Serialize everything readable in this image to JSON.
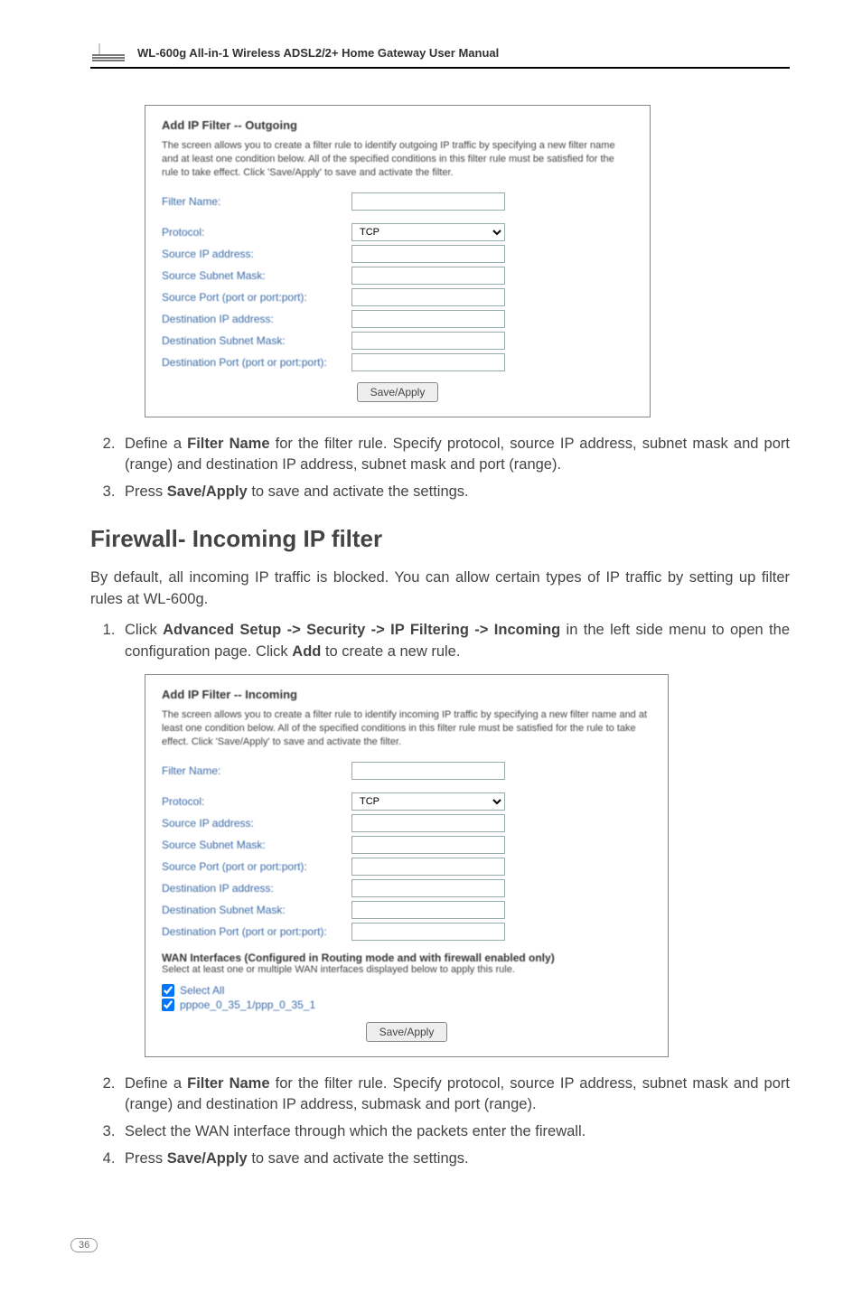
{
  "header": {
    "manual_title": "WL-600g All-in-1 Wireless ADSL2/2+ Home Gateway User Manual"
  },
  "dialog_out": {
    "title": "Add IP Filter -- Outgoing",
    "desc": "The screen allows you to create a filter rule to identify outgoing IP traffic by specifying a new filter name and at least one condition below. All of the specified conditions in this filter rule must be satisfied for the rule to take effect. Click 'Save/Apply' to save and activate the filter.",
    "labels": {
      "filter_name": "Filter Name:",
      "protocol": "Protocol:",
      "src_ip": "Source IP address:",
      "src_mask": "Source Subnet Mask:",
      "src_port": "Source Port (port or port:port):",
      "dst_ip": "Destination IP address:",
      "dst_mask": "Destination Subnet Mask:",
      "dst_port": "Destination Port (port or port:port):"
    },
    "protocol_value": "TCP",
    "button": "Save/Apply"
  },
  "steps_out": {
    "s2": "Define a <b>Filter Name</b> for the filter rule. Specify protocol, source IP address, subnet mask and port (range) and destination IP address, subnet mask and port (range).",
    "s3_pre": "Press ",
    "s3_bold": "Save/Apply",
    "s3_post": " to save and activate the settings."
  },
  "section_title": "Firewall- Incoming IP filter",
  "section_intro": "By default, all incoming IP traffic is blocked. You can allow certain types of IP traffic by setting up filter rules at WL-600g.",
  "steps_in_top": {
    "s1_pre": "Click ",
    "s1_bold": "Advanced Setup -> Security -> IP Filtering -> Incoming",
    "s1_mid": " in the left side menu to open the configuration page. Click ",
    "s1_bold2": "Add",
    "s1_post": " to create a new rule."
  },
  "dialog_in": {
    "title": "Add IP Filter -- Incoming",
    "desc": "The screen allows you to create a filter rule to identify incoming IP traffic by specifying a new filter name and at least one condition below. All of the specified conditions in this filter rule must be satisfied for the rule to take effect. Click 'Save/Apply' to save and activate the filter.",
    "labels": {
      "filter_name": "Filter Name:",
      "protocol": "Protocol:",
      "src_ip": "Source IP address:",
      "src_mask": "Source Subnet Mask:",
      "src_port": "Source Port (port or port:port):",
      "dst_ip": "Destination IP address:",
      "dst_mask": "Destination Subnet Mask:",
      "dst_port": "Destination Port (port or port:port):"
    },
    "protocol_value": "TCP",
    "wan_heading": "WAN Interfaces (Configured in Routing mode and with firewall enabled only)",
    "wan_sub": "Select at least one or multiple WAN interfaces displayed below to apply this rule.",
    "check_all": "Select All",
    "check_if": "pppoe_0_35_1/ppp_0_35_1",
    "button": "Save/Apply"
  },
  "steps_in": {
    "s2": "Define a <b>Filter Name</b> for the filter rule. Specify protocol, source IP address, subnet mask and port (range) and destination IP address, submask and port (range).",
    "s3": "Select the WAN interface through which the packets enter the firewall.",
    "s4_pre": "Press ",
    "s4_bold": "Save/Apply",
    "s4_post": " to save and activate the settings."
  },
  "page_number": "36",
  "chart_data": null
}
